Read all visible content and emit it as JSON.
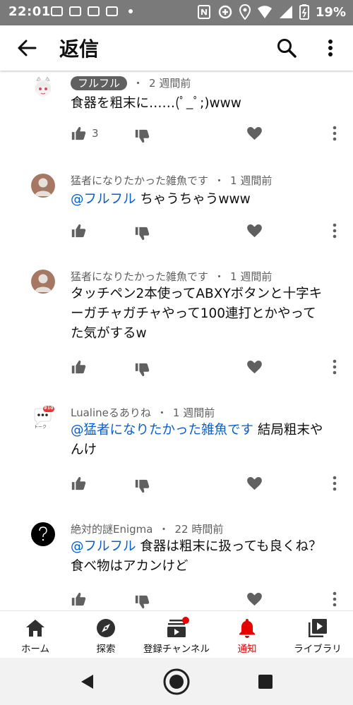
{
  "status_bar": {
    "time": "22:01",
    "battery": "19%"
  },
  "app_bar": {
    "title": "返信"
  },
  "comments": [
    {
      "author": "フルフル",
      "author_style": "chip",
      "time": "2 週間前",
      "mention": "",
      "text": "食器を粗末に……(ﾟ_ﾟ;)www",
      "likes": "3",
      "avatar": "anime-avatar"
    },
    {
      "author": "猛者になりたかった雑魚です",
      "time": "1 週間前",
      "mention": "@フルフル",
      "text": "ちゃうちゃうwww",
      "likes": "",
      "avatar": "default-avatar"
    },
    {
      "author": "猛者になりたかった雑魚です",
      "time": "1 週間前",
      "mention": "",
      "text_lines": [
        "タッチペン2本使ってABXYボタンと十字キ",
        "ーガチャガチャやって100連打とかやって",
        "た気がするw"
      ],
      "likes": "",
      "avatar": "default-avatar"
    },
    {
      "author": "Lualineるありね",
      "time": "1 週間前",
      "mention": "@猛者になりたかった雑魚です",
      "text_after_mention": "結局粗末や",
      "text_line2": "んけ",
      "likes": "",
      "avatar": "talk-avatar",
      "avatar_badge": "#10",
      "avatar_label": "トーク"
    },
    {
      "author": "絶対的謎Enigma",
      "time": "22 時間前",
      "mention": "@フルフル",
      "text_after_mention": "食器は粗末に扱っても良くね？",
      "text_line2": "食べ物はアカンけど",
      "likes": "",
      "avatar": "question-avatar"
    }
  ],
  "bottom_nav": [
    {
      "label": "ホーム",
      "icon": "home-icon",
      "active": false
    },
    {
      "label": "探索",
      "icon": "explore-icon",
      "active": false
    },
    {
      "label": "登録チャンネル",
      "icon": "subscriptions-icon",
      "active": false
    },
    {
      "label": "通知",
      "icon": "bell-icon",
      "active": true
    },
    {
      "label": "ライブラリ",
      "icon": "library-icon",
      "active": false
    }
  ],
  "colors": {
    "mention": "#065fd4",
    "active": "#e60000",
    "icon": "#606060",
    "status_bar": "#7a7a7a"
  }
}
